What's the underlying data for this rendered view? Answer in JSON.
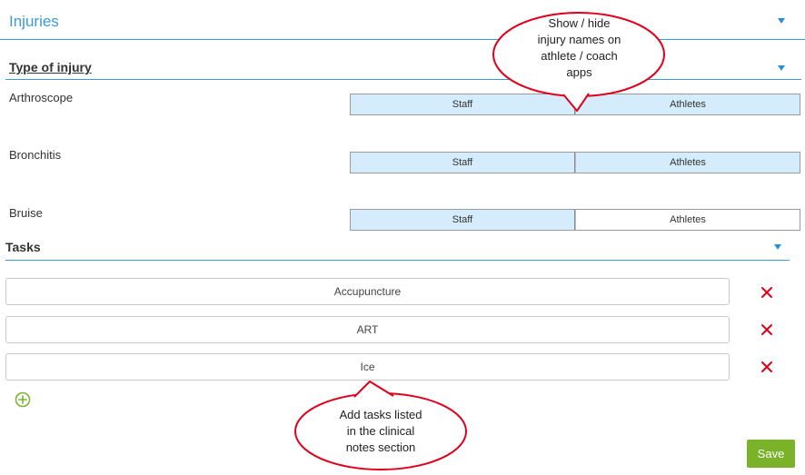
{
  "sections": {
    "injuries_title": "Injuries",
    "type_of_injury_title": "Type of injury",
    "tasks_title": "Tasks"
  },
  "injuries": [
    {
      "name": "Arthroscope",
      "staff_label": "Staff",
      "athletes_label": "Athletes",
      "staff_on": true,
      "athletes_on": true
    },
    {
      "name": "Bronchitis",
      "staff_label": "Staff",
      "athletes_label": "Athletes",
      "staff_on": true,
      "athletes_on": true
    },
    {
      "name": "Bruise",
      "staff_label": "Staff",
      "athletes_label": "Athletes",
      "staff_on": true,
      "athletes_on": false
    }
  ],
  "tasks": [
    "Accupuncture",
    "ART",
    "Ice"
  ],
  "save_label": "Save",
  "callouts": {
    "top_lines": [
      "Show / hide",
      "injury names on",
      "athlete / coach",
      "apps"
    ],
    "bottom_lines": [
      "Add tasks listed",
      "in the clinical",
      "notes section"
    ]
  },
  "colors": {
    "accent": "#3a9bd5",
    "toggle_on": "#d4ecfb",
    "delete": "#e0001b",
    "add": "#7ab22a",
    "save": "#7ab22a",
    "callout_border": "#e0001b"
  },
  "icons": {
    "collapse": "caret-down-icon",
    "delete": "close-icon",
    "add": "add-circle-icon"
  }
}
